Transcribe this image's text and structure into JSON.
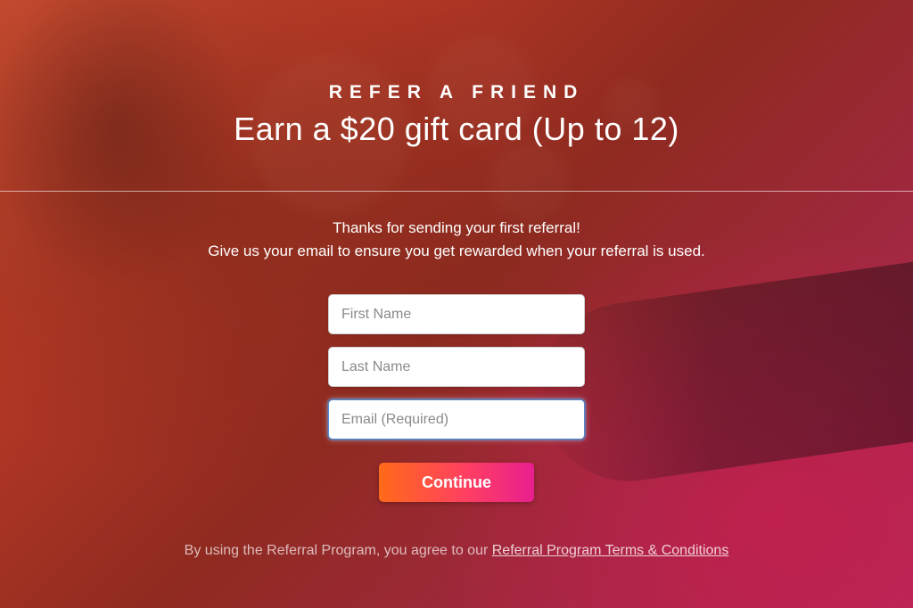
{
  "header": {
    "eyebrow": "REFER A FRIEND",
    "headline": "Earn a $20 gift card (Up to 12)"
  },
  "message": {
    "line1": "Thanks for sending your first referral!",
    "line2": "Give us your email to ensure you get rewarded when your referral is used."
  },
  "form": {
    "first_name": {
      "placeholder": "First Name",
      "value": ""
    },
    "last_name": {
      "placeholder": "Last Name",
      "value": ""
    },
    "email": {
      "placeholder": "Email (Required)",
      "value": ""
    },
    "submit_label": "Continue"
  },
  "legal": {
    "prefix": "By using the Referral Program, you agree to our ",
    "link_text": "Referral Program Terms & Conditions"
  }
}
